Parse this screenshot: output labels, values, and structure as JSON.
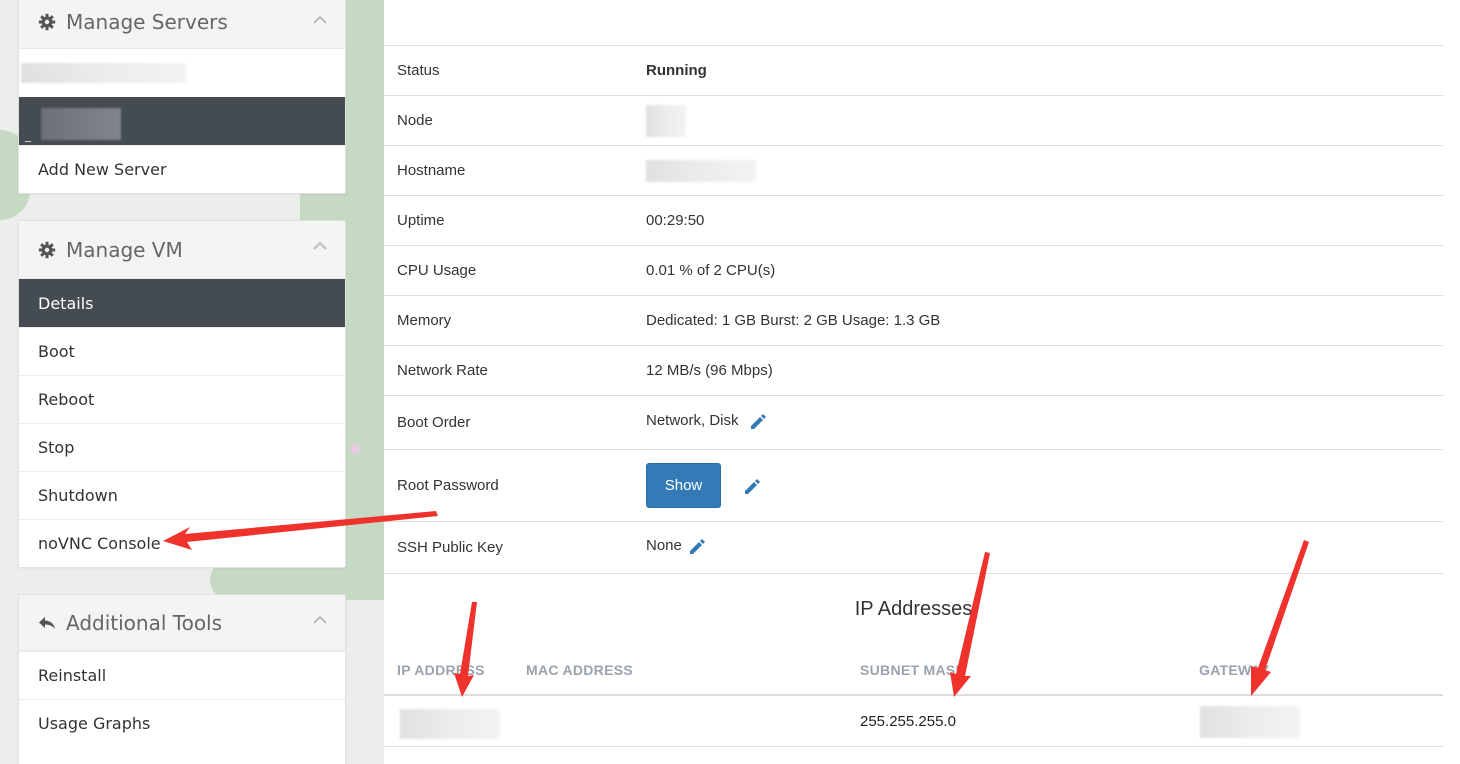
{
  "sidebar": {
    "servers_panel": {
      "title": "Manage Servers",
      "add_label": "Add New Server"
    },
    "vm_panel": {
      "title": "Manage VM",
      "items": [
        "Details",
        "Boot",
        "Reboot",
        "Stop",
        "Shutdown",
        "noVNC Console"
      ]
    },
    "tools_panel": {
      "title": "Additional Tools",
      "items": [
        "Reinstall",
        "Usage Graphs"
      ]
    }
  },
  "details": {
    "status": {
      "label": "Status",
      "value": "Running"
    },
    "node": {
      "label": "Node"
    },
    "hostname": {
      "label": "Hostname"
    },
    "uptime": {
      "label": "Uptime",
      "value": "00:29:50"
    },
    "cpu": {
      "label": "CPU Usage",
      "value": "0.01 % of 2 CPU(s)"
    },
    "memory": {
      "label": "Memory",
      "value": "Dedicated: 1 GB Burst: 2 GB Usage: 1.3 GB"
    },
    "network": {
      "label": "Network Rate",
      "value": "12 MB/s (96 Mbps)"
    },
    "boot_order": {
      "label": "Boot Order",
      "value": "Network, Disk"
    },
    "root_password": {
      "label": "Root Password",
      "button": "Show"
    },
    "ssh_key": {
      "label": "SSH Public Key",
      "value": "None"
    }
  },
  "ip_addresses": {
    "title": "IP Addresses",
    "columns": [
      "IP ADDRESS",
      "MAC ADDRESS",
      "SUBNET MASK",
      "GATEWAY"
    ],
    "rows": [
      {
        "subnet": "255.255.255.0"
      }
    ]
  },
  "colors": {
    "active_bg": "#444b51",
    "running": "#118a11",
    "button": "#337ab7",
    "arrow": "#f0322d"
  }
}
